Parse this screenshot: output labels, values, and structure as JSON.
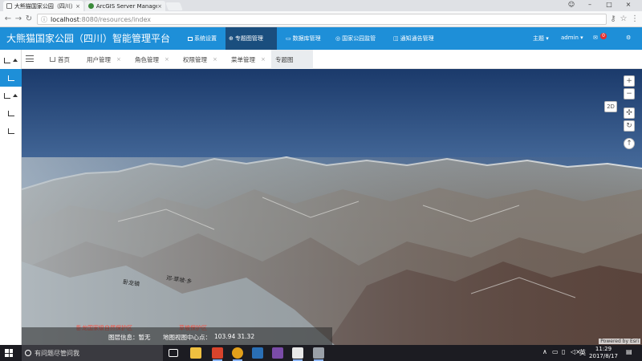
{
  "browser": {
    "tabs": [
      {
        "title": "大熊猫国家公园（四川）",
        "close": "×"
      },
      {
        "title": "ArcGIS Server Manager",
        "close": "×"
      }
    ],
    "url_host": "localhost",
    "url_path": ":8080/resources/index"
  },
  "app": {
    "title": "大熊猫国家公园（四川）智能管理平台",
    "nav": [
      {
        "label": "系统设置"
      },
      {
        "label": "专题图管理"
      },
      {
        "label": "数据库管理"
      },
      {
        "label": "国家公园监管"
      },
      {
        "label": "通知通告管理"
      }
    ],
    "theme_label": "主题",
    "user_label": "admin",
    "message_count": "0"
  },
  "page_tabs": [
    {
      "label": "首页"
    },
    {
      "label": "用户管理"
    },
    {
      "label": "角色管理"
    },
    {
      "label": "权限管理"
    },
    {
      "label": "菜单管理"
    },
    {
      "label": "专题图"
    }
  ],
  "tab_close": "×",
  "map": {
    "view_mode_label": "2D",
    "layer_info": "图层信息：暂无",
    "center_label": "地图视图中心点：",
    "center_coords": "103.94  31.32",
    "attribution": "Powered by Esri",
    "zoom_in": "+",
    "zoom_out": "−",
    "terrain_text_1": "卧龙镇",
    "terrain_text_2": "邓·草坡·乡",
    "red_label_1": "卧龙国家级自然保护区",
    "red_label_2": "草坡保护区"
  },
  "taskbar": {
    "search_placeholder": "有问题尽管问我",
    "time": "11:29",
    "date": "2017/8/17",
    "ime": "英",
    "chevron": "∧",
    "volume": "◁×"
  },
  "colors": {
    "header_bg": "#1e8fd8",
    "active_nav_bg": "#1a4e7e",
    "badge": "#e52e2e",
    "taskbar_bg": "#1c1c22"
  }
}
